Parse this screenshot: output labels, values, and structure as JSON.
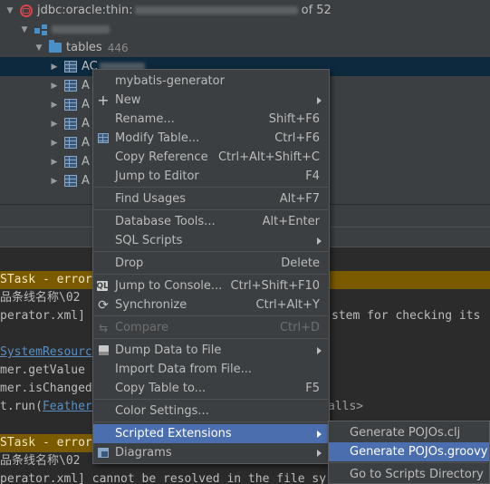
{
  "tree": {
    "connection_label": "jdbc:oracle:thin:",
    "connection_suffix": "of 52",
    "tables_label": "tables",
    "tables_count": "446",
    "selected_table_prefix": "AC",
    "table_prefix": "A"
  },
  "console": {
    "lines": [
      "STask - error",
      "品条线名称\\02",
      "perator.xml]",
      "stem for checking its",
      "SystemResource",
      "mer.getValue",
      "mer.isChanged",
      "t.run(",
      "FeatherX",
      "alls>",
      "STask - error",
      "品条线名称\\02",
      "perator.xml] cannot be resolved in the file sy"
    ]
  },
  "context_menu": {
    "title": "mybatis-generator",
    "items": {
      "new": "New",
      "rename": "Rename...",
      "rename_sc": "Shift+F6",
      "modify_table": "Modify Table...",
      "modify_table_sc": "Ctrl+F6",
      "copy_reference": "Copy Reference",
      "copy_reference_sc": "Ctrl+Alt+Shift+C",
      "jump_to_editor": "Jump to Editor",
      "jump_to_editor_sc": "F4",
      "find_usages": "Find Usages",
      "find_usages_sc": "Alt+F7",
      "database_tools": "Database Tools...",
      "database_tools_sc": "Alt+Enter",
      "sql_scripts": "SQL Scripts",
      "drop": "Drop",
      "drop_sc": "Delete",
      "jump_to_console": "Jump to Console...",
      "jump_to_console_sc": "Ctrl+Shift+F10",
      "synchronize": "Synchronize",
      "synchronize_sc": "Ctrl+Alt+Y",
      "compare": "Compare",
      "compare_sc": "Ctrl+D",
      "dump_data": "Dump Data to File",
      "import_data": "Import Data from File...",
      "copy_table": "Copy Table to...",
      "copy_table_sc": "F5",
      "color_settings": "Color Settings...",
      "scripted_extensions": "Scripted Extensions",
      "diagrams": "Diagrams"
    }
  },
  "submenu": {
    "generate_clj": "Generate POJOs.clj",
    "generate_groovy": "Generate POJOs.groovy",
    "go_to_scripts": "Go to Scripts Directory"
  },
  "colors": {
    "menu_bg": "#3c3f41",
    "highlight": "#4b6eaf",
    "error_bar": "#7a5b00",
    "selected_row": "#0d293e"
  }
}
